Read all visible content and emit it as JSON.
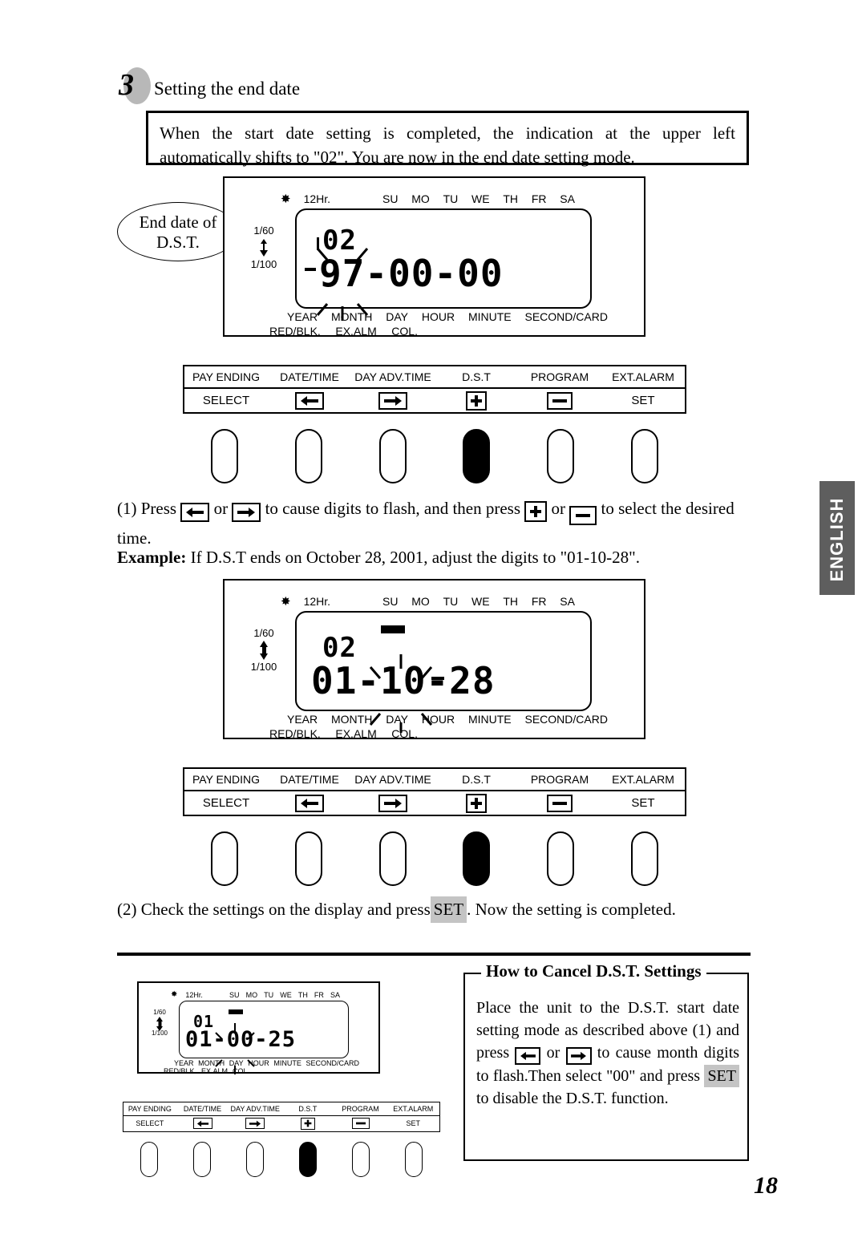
{
  "step": {
    "number": "3",
    "title": "Setting the end date",
    "intro": "When the start date setting is completed, the indication at the upper left automatically shifts to \"02\".  You are now in the end date setting mode."
  },
  "callout": {
    "line1": "End date of",
    "line2": "D.S.T."
  },
  "lcd": {
    "top_indicators": [
      "12Hr."
    ],
    "gear_icon": "gear-icon",
    "weekdays": [
      "SU",
      "MO",
      "TU",
      "WE",
      "TH",
      "FR",
      "SA"
    ],
    "rate_top": "1/60",
    "rate_bottom": "1/100",
    "footer_row1": [
      "YEAR",
      "MONTH",
      "DAY",
      "HOUR",
      "MINUTE",
      "SECOND/CARD"
    ],
    "footer_row2": [
      "RED/BLK.",
      "EX.ALM",
      "COL."
    ]
  },
  "display1": {
    "mode": "02",
    "value": "97-00-00",
    "flashing_field": "YEAR"
  },
  "display2": {
    "mode": "02",
    "value": "01-10-28",
    "flashing_field": "DAY"
  },
  "display3": {
    "mode": "01",
    "value": "01-00-25",
    "flashing_field": "MONTH"
  },
  "keypanel": {
    "functions": [
      "PAY ENDING",
      "DATE/TIME",
      "DAY ADV.TIME",
      "D.S.T",
      "PROGRAM",
      "EXT.ALARM"
    ],
    "keys": [
      "SELECT",
      "arrow-left-icon",
      "arrow-right-icon",
      "plus-icon",
      "minus-icon",
      "SET"
    ],
    "key_labels": [
      "SELECT",
      "",
      "",
      "",
      "",
      "SET"
    ],
    "active_key_index": 3
  },
  "instructions": {
    "step1_a": "(1) Press",
    "step1_or1": "or",
    "step1_b": "to cause digits to flash, and then press",
    "step1_or2": "or",
    "step1_c": "to select the desired time.",
    "example_label": "Example:",
    "example_text": "If D.S.T ends on October 28, 2001, adjust the digits to \"01-10-28\".",
    "step2": "(2) Check the settings on the display and press",
    "step2_key": "SET",
    "step2_tail": ".  Now the setting is completed."
  },
  "cancel_panel": {
    "title": "How to Cancel D.S.T. Settings",
    "part1": "Place the unit to the D.S.T. start date setting mode as described above (1) and press",
    "or": "or",
    "part2": "to cause month digits to flash.Then select \"00\" and press",
    "set_key": "SET",
    "part3": "to disable the D.S.T. function."
  },
  "sidebar": {
    "language_tab": "ENGLISH"
  },
  "footer": {
    "page_number": "18"
  },
  "colors": {
    "ink": "#000000",
    "tab_background": "#5e5e5e",
    "set_chip": "#c4c4c4",
    "step_shadow": "#b8b8b8"
  }
}
